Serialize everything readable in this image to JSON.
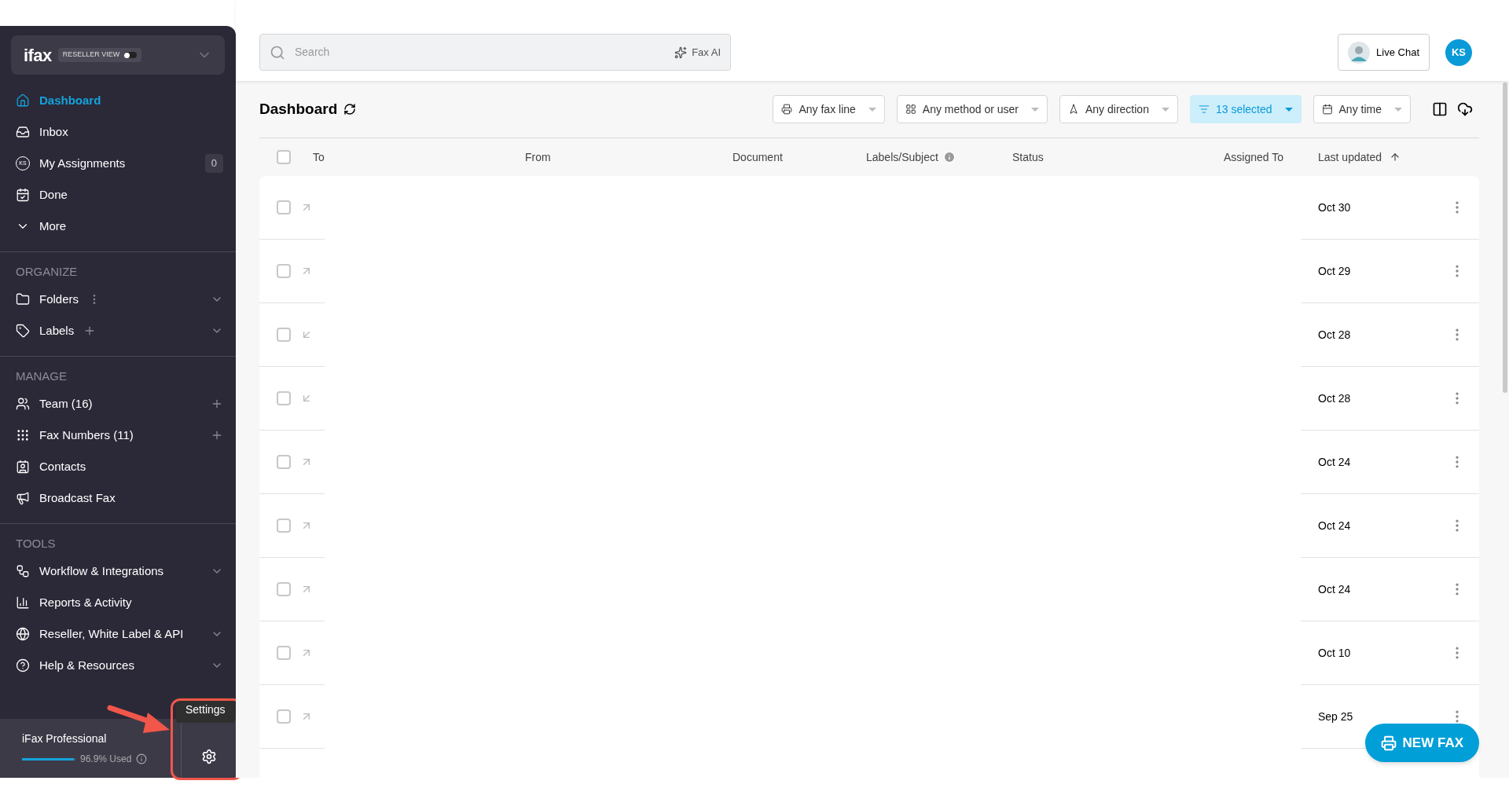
{
  "sidebar": {
    "logo": "ifax",
    "view_toggle": {
      "label": "RESELLER VIEW",
      "on": false
    },
    "nav": [
      {
        "label": "Dashboard",
        "selected": true
      },
      {
        "label": "Inbox",
        "selected": false
      },
      {
        "label": "My Assignments",
        "selected": false,
        "icon_text": "KS",
        "badge": "0"
      },
      {
        "label": "Done",
        "selected": false
      },
      {
        "label": "More",
        "selected": false
      }
    ],
    "sections": [
      {
        "title": "ORGANIZE",
        "items": [
          {
            "label": "Folders",
            "selected": false,
            "menu": true,
            "expandable": true
          },
          {
            "label": "Labels",
            "selected": false,
            "addable": true,
            "expandable": true
          }
        ]
      },
      {
        "title": "MANAGE",
        "items": [
          {
            "label": "Team (16)",
            "selected": false,
            "addable": true,
            "expandable": false
          },
          {
            "label": "Fax Numbers (11)",
            "selected": false,
            "addable": true,
            "expandable": false
          },
          {
            "label": "Contacts",
            "selected": false
          },
          {
            "label": "Broadcast Fax",
            "selected": false
          }
        ]
      },
      {
        "title": "TOOLS",
        "items": [
          {
            "label": "Workflow & Integrations",
            "selected": false,
            "expandable": true
          },
          {
            "label": "Reports & Activity",
            "selected": false
          },
          {
            "label": "Reseller, White Label & API",
            "selected": false,
            "expandable": true
          },
          {
            "label": "Help & Resources",
            "selected": false,
            "expandable": true
          }
        ]
      }
    ],
    "plan": {
      "name": "iFax Professional",
      "level": 0.969,
      "usage": "96.9% Used"
    },
    "settings_tooltip": "Settings"
  },
  "header": {
    "search_placeholder": "Search",
    "ai_button": "Fax AI",
    "live_chat": "Live Chat",
    "user_initials": "KS"
  },
  "toolbar": {
    "title": "Dashboard",
    "filters": [
      {
        "label": "Any fax line",
        "selected": false
      },
      {
        "label": "Any method or user",
        "selected": false
      },
      {
        "label": "Any direction",
        "selected": false
      },
      {
        "label": "13 selected",
        "selected": true
      },
      {
        "label": "Any time",
        "selected": false
      }
    ]
  },
  "table": {
    "all_checked": false,
    "columns": [
      {
        "label": "To"
      },
      {
        "label": "From"
      },
      {
        "label": "Document"
      },
      {
        "label": "Labels/Subject",
        "info": true
      },
      {
        "label": "Status"
      },
      {
        "label": "Assigned To"
      },
      {
        "label": "Last updated",
        "sorted": true
      }
    ],
    "rows": [
      {
        "checked": false,
        "incoming": false,
        "last_updated": "Oct 30"
      },
      {
        "checked": false,
        "incoming": false,
        "last_updated": "Oct 29"
      },
      {
        "checked": false,
        "incoming": true,
        "last_updated": "Oct 28"
      },
      {
        "checked": false,
        "incoming": true,
        "last_updated": "Oct 28"
      },
      {
        "checked": false,
        "incoming": false,
        "last_updated": "Oct 24"
      },
      {
        "checked": false,
        "incoming": false,
        "last_updated": "Oct 24"
      },
      {
        "checked": false,
        "incoming": false,
        "last_updated": "Oct 24"
      },
      {
        "checked": false,
        "incoming": false,
        "last_updated": "Oct 10"
      },
      {
        "checked": false,
        "incoming": false,
        "last_updated": "Sep 25"
      }
    ]
  },
  "new_fax_button": "NEW FAX"
}
